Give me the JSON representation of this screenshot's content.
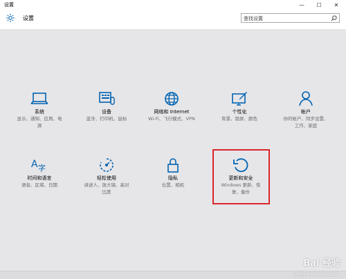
{
  "window": {
    "title": "设置",
    "controls": [
      "—",
      "☐",
      "✕"
    ]
  },
  "header": {
    "heading": "设置",
    "search_placeholder": "查找设置"
  },
  "categories": [
    {
      "label": "系统",
      "desc_lines": [
        "显示、通知、应用、电",
        "源"
      ],
      "icon": "laptop-icon"
    },
    {
      "label": "设备",
      "desc_lines": [
        "蓝牙、打印机、鼠标"
      ],
      "icon": "keyboard-icon"
    },
    {
      "label": "网络和 Internet",
      "desc_lines": [
        "Wi-Fi、飞行模式、VPN"
      ],
      "icon": "globe-icon"
    },
    {
      "label": "个性化",
      "desc_lines": [
        "背景、锁屏、颜色"
      ],
      "icon": "paint-monitor-icon"
    },
    {
      "label": "帐户",
      "desc_lines": [
        "你的帐户、同步设置、",
        "工作、家庭"
      ],
      "icon": "person-icon"
    },
    {
      "label": "时间和语言",
      "desc_lines": [
        "语音、区域、日期"
      ],
      "icon": "time-language-icon"
    },
    {
      "label": "轻松使用",
      "desc_lines": [
        "讲述人、放大镜、高对",
        "比度"
      ],
      "icon": "ease-of-access-icon"
    },
    {
      "label": "隐私",
      "desc_lines": [
        "位置、相机"
      ],
      "icon": "lock-icon"
    },
    {
      "label": "更新和安全",
      "desc_lines": [
        "Windows 更新、恢",
        "复、备份"
      ],
      "icon": "refresh-icon"
    }
  ],
  "watermark": {
    "text": "Bai 经验",
    "sub": "jingyan.baidu.com"
  },
  "colors": {
    "accent": "#0063b1",
    "highlight_border": "#d8262a"
  }
}
